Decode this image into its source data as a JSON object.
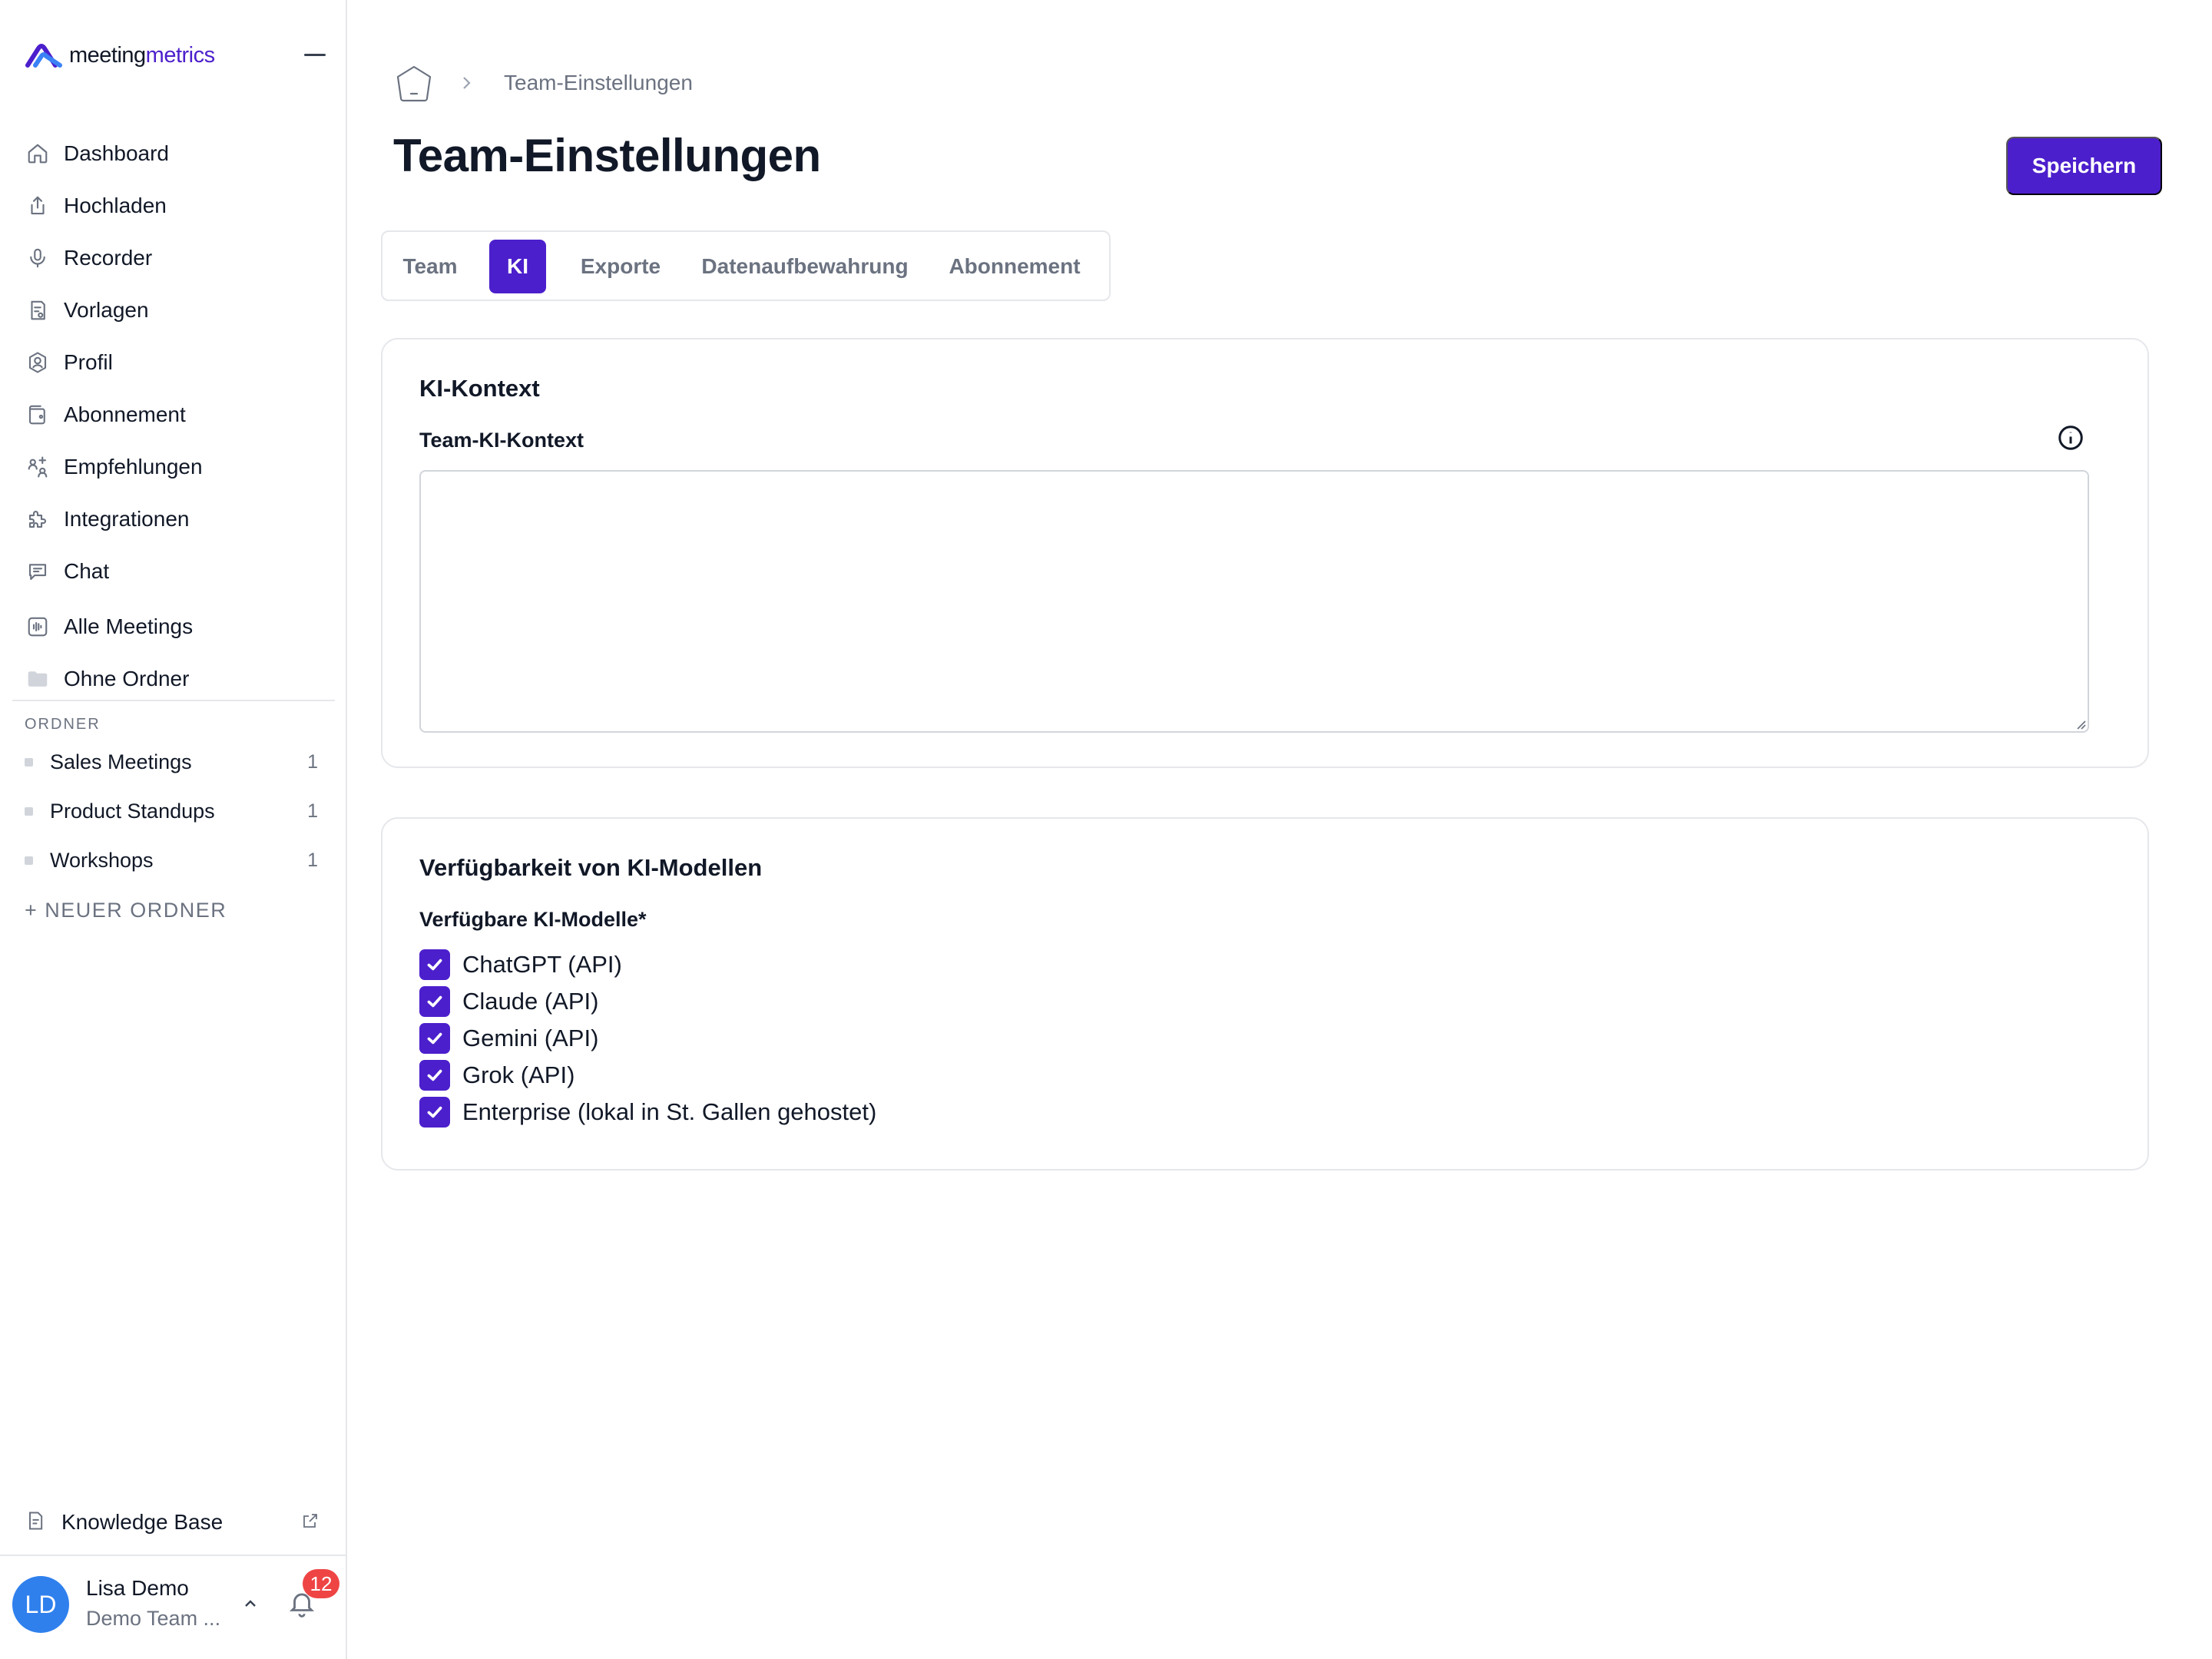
{
  "brand": {
    "part1": "meeting",
    "part2": "metrics"
  },
  "colors": {
    "accent": "#4c1fcc",
    "avatar": "#2f80ed",
    "badge": "#ef4444"
  },
  "sidebar": {
    "items": [
      {
        "label": "Dashboard",
        "icon": "home-icon"
      },
      {
        "label": "Hochladen",
        "icon": "upload-icon"
      },
      {
        "label": "Recorder",
        "icon": "microphone-icon"
      },
      {
        "label": "Vorlagen",
        "icon": "template-icon"
      },
      {
        "label": "Profil",
        "icon": "profile-icon"
      },
      {
        "label": "Abonnement",
        "icon": "wallet-icon"
      },
      {
        "label": "Empfehlungen",
        "icon": "referral-icon"
      },
      {
        "label": "Integrationen",
        "icon": "puzzle-icon"
      },
      {
        "label": "Chat",
        "icon": "chat-icon"
      },
      {
        "label": "Alle Meetings",
        "icon": "audio-wave-icon"
      },
      {
        "label": "Ohne Ordner",
        "icon": "folder-icon"
      }
    ],
    "folders_heading": "ORDNER",
    "folders": [
      {
        "label": "Sales Meetings",
        "count": "1"
      },
      {
        "label": "Product Standups",
        "count": "1"
      },
      {
        "label": "Workshops",
        "count": "1"
      }
    ],
    "new_folder": "+ NEUER ORDNER",
    "knowledge_base": "Knowledge Base",
    "user": {
      "initials": "LD",
      "name": "Lisa Demo",
      "team": "Demo Team ..."
    },
    "notifications_count": "12"
  },
  "header": {
    "breadcrumb": "Team-Einstellungen",
    "title": "Team-Einstellungen",
    "save_label": "Speichern"
  },
  "tabs": [
    {
      "label": "Team",
      "active": false
    },
    {
      "label": "KI",
      "active": true
    },
    {
      "label": "Exporte",
      "active": false
    },
    {
      "label": "Datenaufbewahrung",
      "active": false
    },
    {
      "label": "Abonnement",
      "active": false
    }
  ],
  "ki_context": {
    "title": "KI-Kontext",
    "field_label": "Team-KI-Kontext",
    "value": ""
  },
  "models": {
    "title": "Verfügbarkeit von KI-Modellen",
    "field_label": "Verfügbare KI-Modelle*",
    "options": [
      {
        "label": "ChatGPT (API)",
        "checked": true
      },
      {
        "label": "Claude (API)",
        "checked": true
      },
      {
        "label": "Gemini (API)",
        "checked": true
      },
      {
        "label": "Grok (API)",
        "checked": true
      },
      {
        "label": "Enterprise (lokal in St. Gallen gehostet)",
        "checked": true
      }
    ]
  }
}
